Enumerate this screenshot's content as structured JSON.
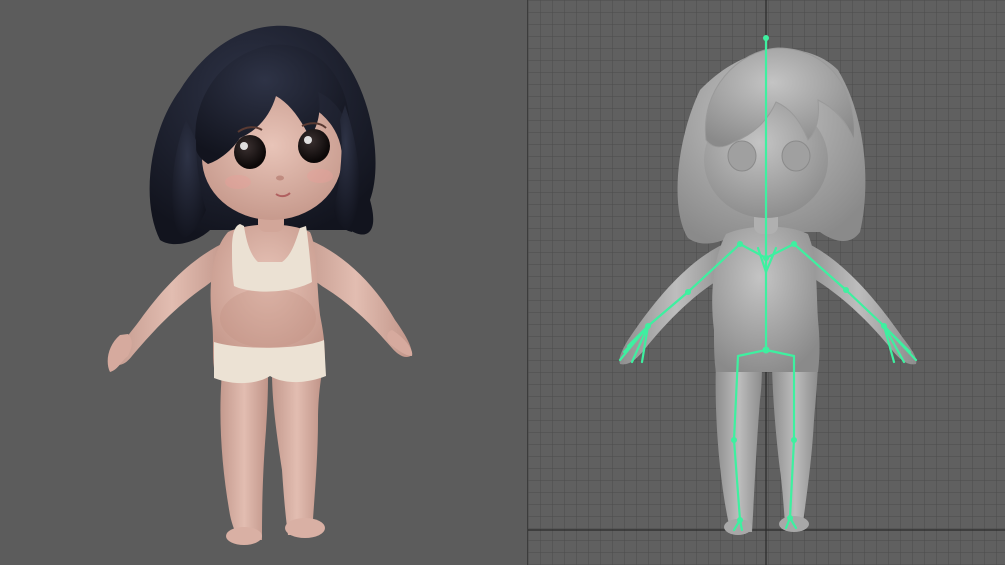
{
  "app": {
    "title": ""
  },
  "viewports": [
    {
      "id": "left",
      "mode": "textured-render",
      "background": "#5c5c5c"
    },
    {
      "id": "right",
      "mode": "wireframe-grid-with-skeleton",
      "background": "#606060"
    }
  ],
  "colors": {
    "skin": "#d8b2a6",
    "skin_shadow": "#b88c80",
    "hair": "#1a1d2c",
    "underwear": "#ece2d4",
    "clay": "#a8a8a8",
    "clay_shadow": "#8a8a8a",
    "grid_line": "#4a4a4a",
    "skeleton": "#3ef0a0",
    "divider": "#3c3c3c"
  },
  "icons": {
    "character": "character-render",
    "rig": "skeleton-rig"
  }
}
